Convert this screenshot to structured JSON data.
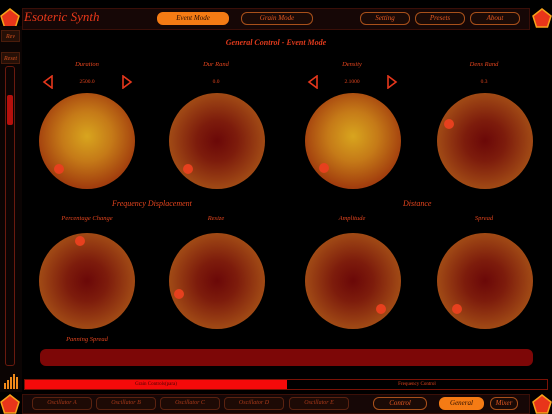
{
  "app": {
    "title": "Esoteric Synth"
  },
  "top_nav": {
    "event_mode": "Event Mode",
    "grain_mode": "Grain Mode",
    "setting": "Setting",
    "presets": "Presets",
    "about": "About"
  },
  "sidebar": {
    "rev": "Rev",
    "reset": "Reset",
    "level_fraction": 0.1
  },
  "main": {
    "title": "General Control -  Event Mode",
    "row1": [
      {
        "label": "Duration",
        "value": "2500.0",
        "has_arrows": true
      },
      {
        "label": "Dur Rand",
        "value": "0.0",
        "has_arrows": false
      },
      {
        "label": "Density",
        "value": "2.1000",
        "has_arrows": true
      },
      {
        "label": "Dens Rand",
        "value": "0.3",
        "has_arrows": false
      }
    ],
    "section_freq": "Frequency Displacement",
    "section_dist": "Distance",
    "row2": [
      {
        "label": "Percentage Change"
      },
      {
        "label": "Resize"
      },
      {
        "label": "Amplitude"
      },
      {
        "label": "Spread"
      }
    ],
    "panning_label": "Panning Spread"
  },
  "bottom_tabs": {
    "left": "Grain Controls(para)",
    "right": "Frequency Control"
  },
  "bottom_bar": {
    "oscillators": [
      "Oscillator A",
      "Oscillator B",
      "Oscillator C",
      "Oscillator D",
      "Oscillator E"
    ],
    "control": "Control",
    "general": "General",
    "mixer": "Mixer"
  },
  "colors": {
    "accent": "#f57b14",
    "text": "#e33b1d",
    "knob_dark": "#6b0808",
    "knob_gold": "#e0a020"
  }
}
